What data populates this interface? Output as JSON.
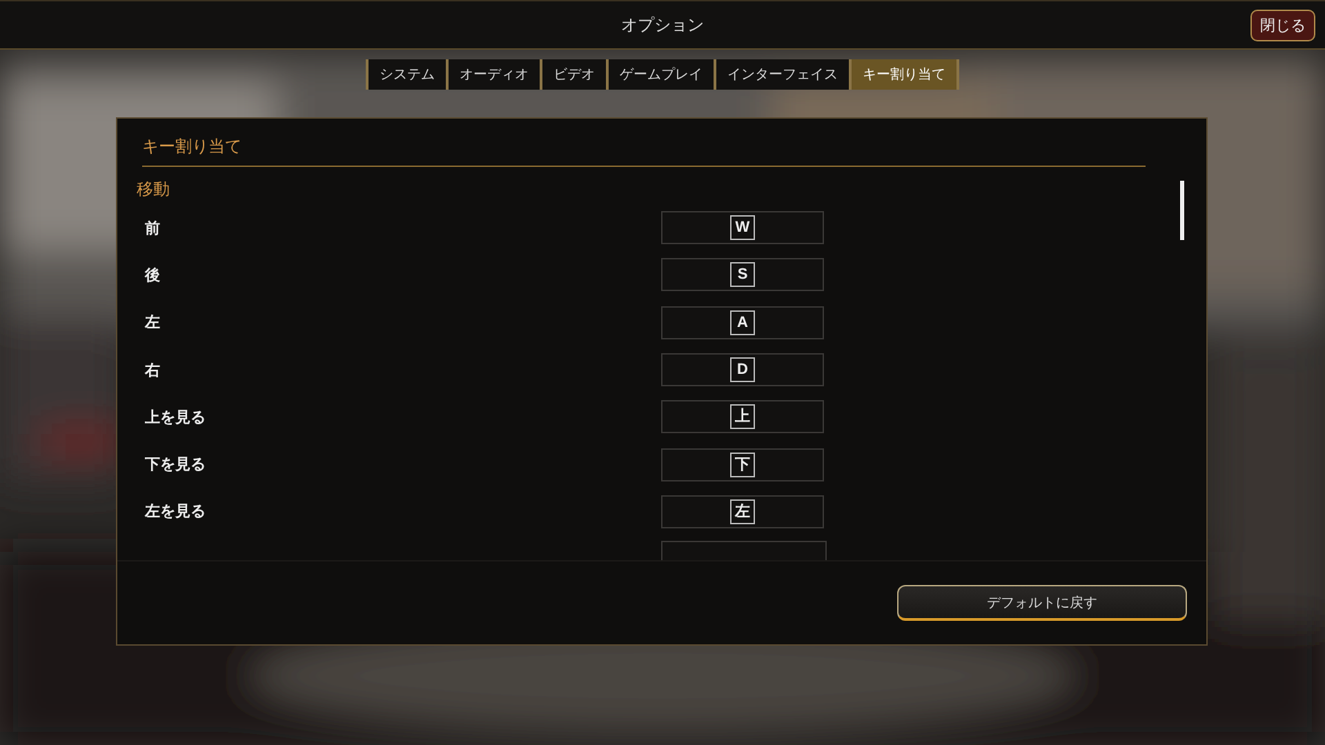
{
  "window": {
    "title": "オプション",
    "close_button": "閉じる"
  },
  "tabs": [
    {
      "label": "システム",
      "selected": false
    },
    {
      "label": "オーディオ",
      "selected": false
    },
    {
      "label": "ビデオ",
      "selected": false
    },
    {
      "label": "ゲームプレイ",
      "selected": false
    },
    {
      "label": "インターフェイス",
      "selected": false
    },
    {
      "label": "キー割り当て",
      "selected": true
    }
  ],
  "panel": {
    "title": "キー割り当て",
    "section": "移動",
    "bindings": [
      {
        "action": "前",
        "key": "W"
      },
      {
        "action": "後",
        "key": "S"
      },
      {
        "action": "左",
        "key": "A"
      },
      {
        "action": "右",
        "key": "D"
      },
      {
        "action": "上を見る",
        "key": "上"
      },
      {
        "action": "下を見る",
        "key": "下"
      },
      {
        "action": "左を見る",
        "key": "左"
      }
    ],
    "reset_button": "デフォルトに戻す"
  }
}
